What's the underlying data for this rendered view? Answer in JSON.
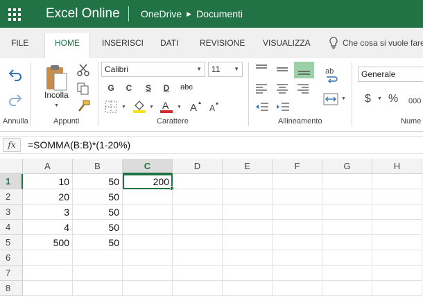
{
  "app": {
    "name": "Excel Online",
    "breadcrumb": [
      "OneDrive",
      "Documenti"
    ]
  },
  "tabs": [
    "FILE",
    "HOME",
    "INSERISCI",
    "DATI",
    "REVISIONE",
    "VISUALIZZA"
  ],
  "active_tab": "HOME",
  "tell_me": "Che cosa si vuole fare",
  "ribbon": {
    "undo_group": "Annulla",
    "clipboard": {
      "paste": "Incolla",
      "label": "Appunti"
    },
    "font": {
      "family": "Calibri",
      "size": "11",
      "bold": "G",
      "italic": "C",
      "underline": "S",
      "double_underline": "D",
      "strikethrough": "abc",
      "label": "Carattere"
    },
    "alignment": {
      "label": "Allineamento"
    },
    "number": {
      "format": "Generale",
      "label": "Nume",
      "currency": "$",
      "percent": "%"
    }
  },
  "formula_bar": {
    "fx": "fx",
    "formula": "=SOMMA(B:B)*(1-20%)"
  },
  "sheet": {
    "columns": [
      "A",
      "B",
      "C",
      "D",
      "E",
      "F",
      "G",
      "H"
    ],
    "rows": [
      {
        "n": "1",
        "cells": [
          "10",
          "50",
          "200",
          "",
          "",
          "",
          "",
          ""
        ]
      },
      {
        "n": "2",
        "cells": [
          "20",
          "50",
          "",
          "",
          "",
          "",
          "",
          ""
        ]
      },
      {
        "n": "3",
        "cells": [
          "3",
          "50",
          "",
          "",
          "",
          "",
          "",
          ""
        ]
      },
      {
        "n": "4",
        "cells": [
          "4",
          "50",
          "",
          "",
          "",
          "",
          "",
          ""
        ]
      },
      {
        "n": "5",
        "cells": [
          "500",
          "50",
          "",
          "",
          "",
          "",
          "",
          ""
        ]
      },
      {
        "n": "6",
        "cells": [
          "",
          "",
          "",
          "",
          "",
          "",
          "",
          ""
        ]
      },
      {
        "n": "7",
        "cells": [
          "",
          "",
          "",
          "",
          "",
          "",
          "",
          ""
        ]
      },
      {
        "n": "8",
        "cells": [
          "",
          "",
          "",
          "",
          "",
          "",
          "",
          ""
        ]
      }
    ],
    "active_cell": "C1"
  },
  "colors": {
    "brand": "#217346",
    "font_color": "#d42a2a",
    "highlight": "#f5e21b",
    "align_selected": "#9dd0a6"
  }
}
